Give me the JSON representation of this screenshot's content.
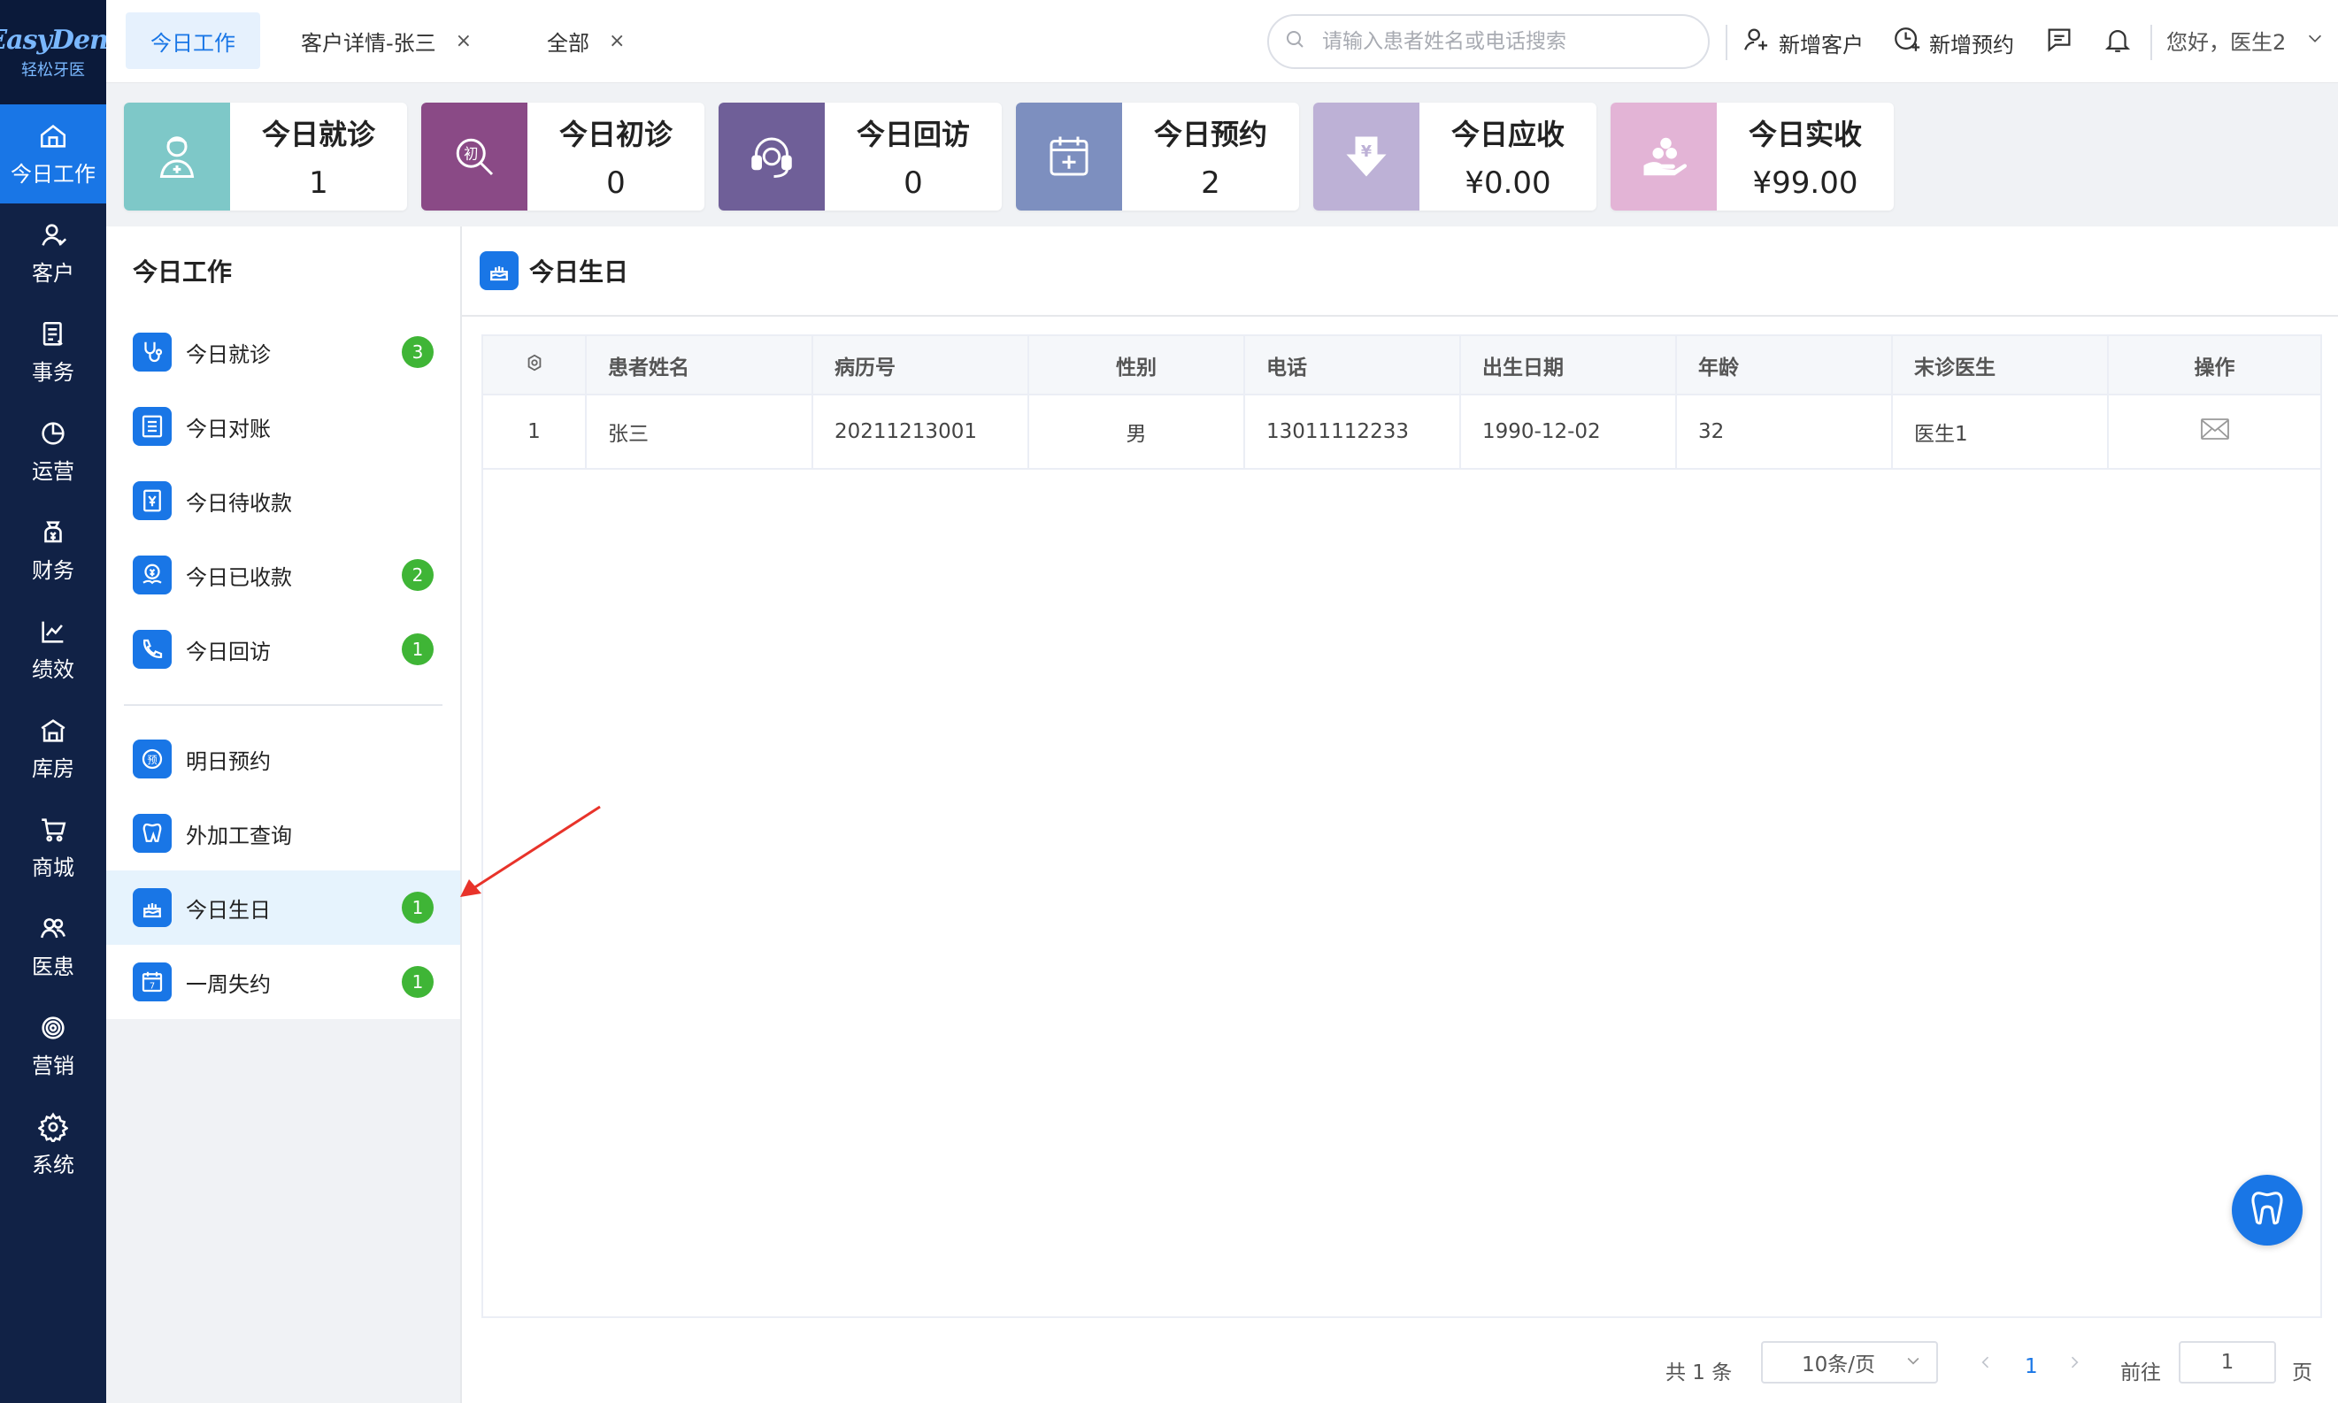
{
  "logo": {
    "line1": "EasyDent",
    "line2": "轻松牙医"
  },
  "nav": [
    {
      "label": "今日工作",
      "icon": "home-icon",
      "active": true
    },
    {
      "label": "客户",
      "icon": "user-icon"
    },
    {
      "label": "事务",
      "icon": "document-icon"
    },
    {
      "label": "运营",
      "icon": "pie-chart-icon"
    },
    {
      "label": "财务",
      "icon": "money-bag-icon"
    },
    {
      "label": "绩效",
      "icon": "line-chart-icon"
    },
    {
      "label": "库房",
      "icon": "warehouse-icon"
    },
    {
      "label": "商城",
      "icon": "cart-icon"
    },
    {
      "label": "医患",
      "icon": "users-icon"
    },
    {
      "label": "营销",
      "icon": "target-icon"
    },
    {
      "label": "系统",
      "icon": "gear-icon"
    }
  ],
  "tabs": [
    {
      "label": "今日工作",
      "active": true
    },
    {
      "label": "客户详情-张三",
      "close": "×"
    },
    {
      "label": "全部",
      "close": "×"
    }
  ],
  "search": {
    "placeholder": "请输入患者姓名或电话搜索"
  },
  "actions": {
    "new_customer": "新增客户",
    "new_appointment": "新增预约",
    "greeting": "您好，医生2"
  },
  "stats": [
    {
      "label": "今日就诊",
      "value": "1",
      "color": "#7ec8c8",
      "icon": "doctor-icon"
    },
    {
      "label": "今日初诊",
      "value": "0",
      "color": "#8a4a86",
      "icon": "first-visit-icon"
    },
    {
      "label": "今日回访",
      "value": "0",
      "color": "#6f5f98",
      "icon": "headset-icon"
    },
    {
      "label": "今日预约",
      "value": "2",
      "color": "#7d8fbf",
      "icon": "calendar-plus-icon"
    },
    {
      "label": "今日应收",
      "value": "¥0.00",
      "color": "#bdb1d6",
      "icon": "yen-down-icon"
    },
    {
      "label": "今日实收",
      "value": "¥99.00",
      "color": "#e3b4d6",
      "icon": "coins-hand-icon"
    }
  ],
  "side": {
    "title": "今日工作",
    "group1": [
      {
        "label": "今日就诊",
        "badge": "3",
        "icon": "stethoscope-icon"
      },
      {
        "label": "今日对账",
        "badge": "",
        "icon": "ledger-icon"
      },
      {
        "label": "今日待收款",
        "badge": "",
        "icon": "pending-payment-icon"
      },
      {
        "label": "今日已收款",
        "badge": "2",
        "icon": "received-payment-icon"
      },
      {
        "label": "今日回访",
        "badge": "1",
        "icon": "phone-followup-icon"
      }
    ],
    "group2": [
      {
        "label": "明日预约",
        "badge": "",
        "icon": "appointment-icon"
      },
      {
        "label": "外加工查询",
        "badge": "",
        "icon": "tooth-lab-icon"
      },
      {
        "label": "今日生日",
        "badge": "1",
        "icon": "cake-icon",
        "active": true
      },
      {
        "label": "一周失约",
        "badge": "1",
        "icon": "calendar-7-icon"
      }
    ]
  },
  "main": {
    "title": "今日生日",
    "columns": [
      "⚙",
      "患者姓名",
      "病历号",
      "性别",
      "电话",
      "出生日期",
      "年龄",
      "末诊医生",
      "操作"
    ],
    "rows": [
      {
        "index": "1",
        "name": "张三",
        "record_no": "20211213001",
        "gender": "男",
        "phone": "13011112233",
        "birth": "1990-12-02",
        "age": "32",
        "doctor": "医生1",
        "action_icon": "mail-icon"
      }
    ]
  },
  "pager": {
    "total": "共 1 条",
    "page_size": "10条/页",
    "current": "1",
    "goto": "前往",
    "goto_value": "1",
    "page": "页"
  },
  "colors": {
    "nav_bg": "#112246",
    "accent": "#1976e6",
    "badge": "#3fb536",
    "arrow": "#e8332a"
  }
}
